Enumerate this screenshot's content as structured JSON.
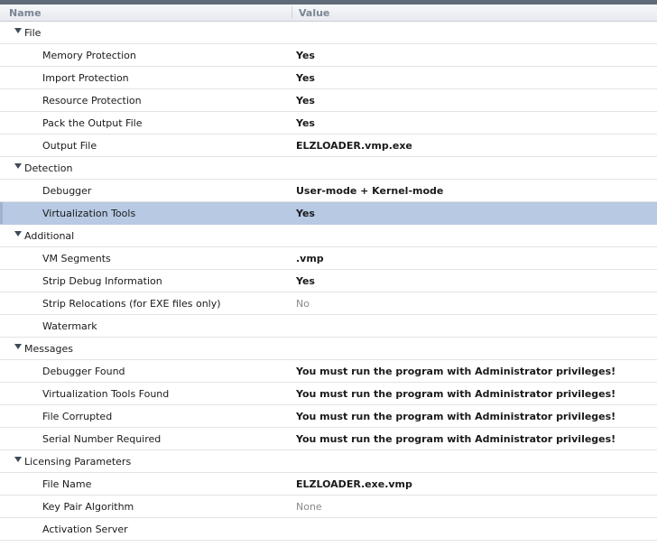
{
  "header": {
    "name_label": "Name",
    "value_label": "Value"
  },
  "categories": [
    {
      "label": "File",
      "items": [
        {
          "name": "Memory Protection",
          "value": "Yes"
        },
        {
          "name": "Import Protection",
          "value": "Yes"
        },
        {
          "name": "Resource Protection",
          "value": "Yes"
        },
        {
          "name": "Pack the Output File",
          "value": "Yes"
        },
        {
          "name": "Output File",
          "value": "ELZLOADER.vmp.exe"
        }
      ]
    },
    {
      "label": "Detection",
      "items": [
        {
          "name": "Debugger",
          "value": "User-mode + Kernel-mode"
        },
        {
          "name": "Virtualization Tools",
          "value": "Yes",
          "selected": true
        }
      ]
    },
    {
      "label": "Additional",
      "items": [
        {
          "name": "VM Segments",
          "value": ".vmp"
        },
        {
          "name": "Strip Debug Information",
          "value": "Yes"
        },
        {
          "name": "Strip Relocations (for EXE files only)",
          "value": "No",
          "dim": true
        },
        {
          "name": "Watermark",
          "value": ""
        }
      ]
    },
    {
      "label": "Messages",
      "items": [
        {
          "name": "Debugger Found",
          "value": "You must run the program with Administrator privileges!"
        },
        {
          "name": "Virtualization Tools Found",
          "value": "You must run the program with Administrator privileges!"
        },
        {
          "name": "File Corrupted",
          "value": "You must run the program with Administrator privileges!"
        },
        {
          "name": "Serial Number Required",
          "value": "You must run the program with Administrator privileges!"
        }
      ]
    },
    {
      "label": "Licensing Parameters",
      "items": [
        {
          "name": "File Name",
          "value": "ELZLOADER.exe.vmp"
        },
        {
          "name": "Key Pair Algorithm",
          "value": "None",
          "dim": true
        },
        {
          "name": "Activation Server",
          "value": ""
        }
      ]
    }
  ]
}
